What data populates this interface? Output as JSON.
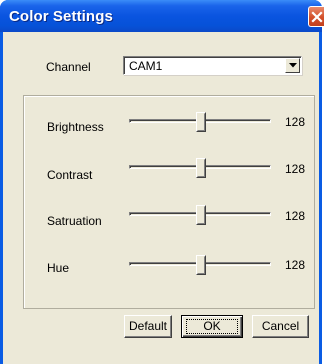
{
  "window": {
    "title": "Color Settings"
  },
  "channel": {
    "label": "Channel",
    "value": "CAM1"
  },
  "sliders": [
    {
      "label": "Brightness",
      "value": "128"
    },
    {
      "label": "Contrast",
      "value": "128"
    },
    {
      "label": "Satruation",
      "value": "128"
    },
    {
      "label": "Hue",
      "value": "128"
    }
  ],
  "buttons": {
    "default_label": "Default",
    "ok_label": "OK",
    "cancel_label": "Cancel"
  },
  "colors": {
    "title_bar": "#0a54e0",
    "client_bg": "#ece9d8",
    "close_button": "#d3502a"
  },
  "icons": {
    "close": "close-icon",
    "dropdown": "chevron-down-icon"
  }
}
